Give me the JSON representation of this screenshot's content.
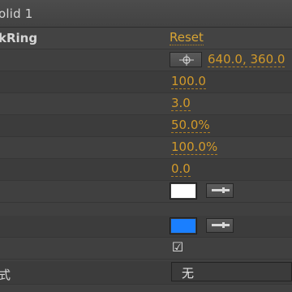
{
  "layer": {
    "title": "olid 1"
  },
  "effect": {
    "name": "kRing",
    "reset_label": "Reset"
  },
  "properties": {
    "center_point": {
      "value": "640.0, 360.0",
      "icon": "crosshair-icon"
    },
    "value_2": "100.0",
    "value_3": "3.0",
    "value_4": "50.0%",
    "value_5": "100.0%",
    "value_6": "0.0",
    "color_1": {
      "swatch": "#ffffff",
      "icon": "eyedropper-icon"
    },
    "color_2": {
      "swatch": "#1a7fff",
      "icon": "eyedropper-icon"
    },
    "checkbox": {
      "checked": true,
      "glyph": "☑"
    },
    "mode": {
      "label": "式",
      "selected": "无"
    }
  },
  "colors": {
    "panel_bg": "#404040",
    "value_orange": "#d29a2a",
    "text": "#d6d6d6"
  }
}
